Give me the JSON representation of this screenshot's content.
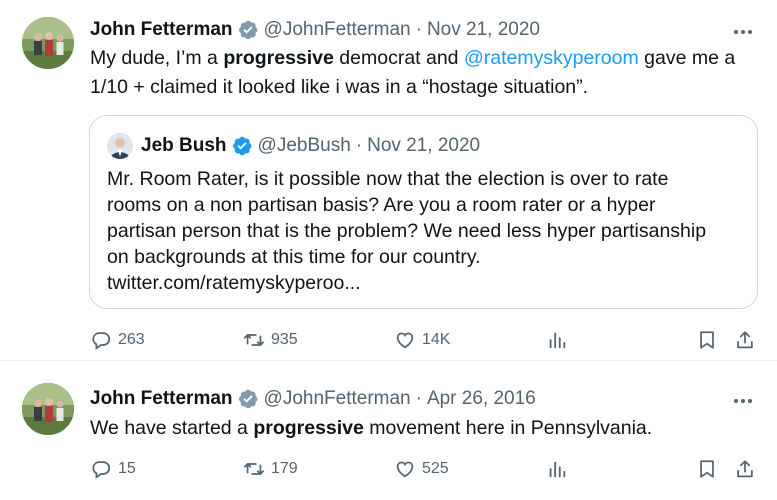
{
  "tweets": [
    {
      "author_name": "John Fetterman",
      "handle": "@JohnFetterman",
      "separator": "·",
      "date": "Nov 21, 2020",
      "text_parts": {
        "p1": "My dude, I’m a ",
        "b1": "progressive",
        "p2": " democrat and ",
        "mention": "@ratemyskyperoom",
        "p3": " gave me a 1/10 + claimed it looked like i was in a “hostage situation”."
      },
      "quote": {
        "author_name": "Jeb Bush",
        "handle": "@JebBush",
        "separator": "·",
        "date": "Nov 21, 2020",
        "lines": [
          "Mr. Room Rater, is it possible now that the election is over to rate",
          "rooms on a non partisan basis? Are you a room rater or a hyper",
          "partisan person that is the problem? We need less hyper partisanship",
          "on backgrounds at this time for our country.",
          "twitter.com/ratemyskyperoo..."
        ]
      },
      "stats": {
        "replies": "263",
        "retweets": "935",
        "likes": "14K"
      }
    },
    {
      "author_name": "John Fetterman",
      "handle": "@JohnFetterman",
      "separator": "·",
      "date": "Apr 26, 2016",
      "text_parts": {
        "p1": "We have started a ",
        "b1": "progressive",
        "p2": " movement here in Pennsylvania."
      },
      "stats": {
        "replies": "15",
        "retweets": "179",
        "likes": "525"
      }
    }
  ],
  "icons": {
    "verified": "verified-badge-icon",
    "more": "more-options-icon",
    "reply": "reply-icon",
    "retweet": "retweet-icon",
    "like": "heart-icon",
    "views": "views-chart-icon",
    "bookmark": "bookmark-icon",
    "share": "share-icon"
  },
  "colors": {
    "text": "#0f1419",
    "secondary": "#536471",
    "link": "#1d9bf0",
    "verified": "#829aab",
    "border": "#cfd9de"
  }
}
